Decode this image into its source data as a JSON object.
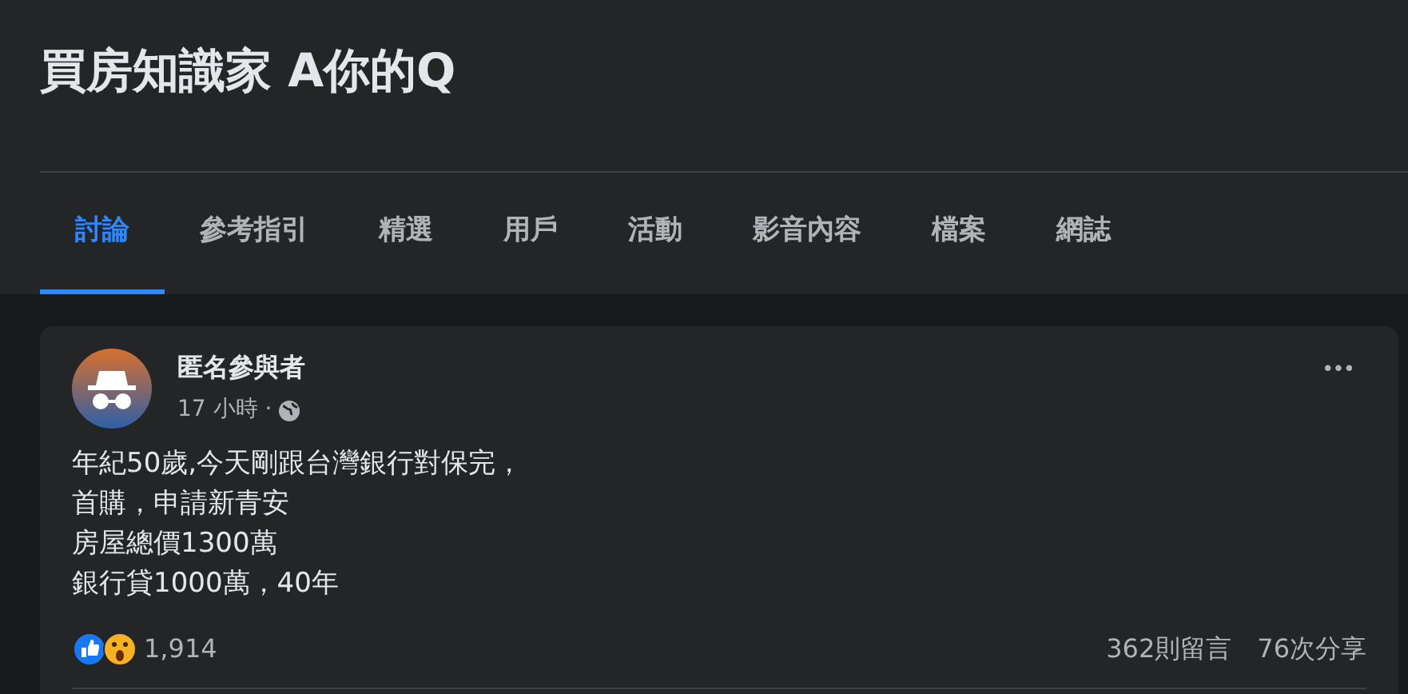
{
  "group": {
    "title": "買房知識家 A你的Q"
  },
  "tabs": [
    {
      "label": "討論",
      "selected": true
    },
    {
      "label": "參考指引",
      "selected": false
    },
    {
      "label": "精選",
      "selected": false
    },
    {
      "label": "用戶",
      "selected": false
    },
    {
      "label": "活動",
      "selected": false
    },
    {
      "label": "影音內容",
      "selected": false
    },
    {
      "label": "檔案",
      "selected": false
    },
    {
      "label": "網誌",
      "selected": false
    }
  ],
  "post": {
    "author": "匿名參與者",
    "time": "17 小時 ·",
    "more": "•••",
    "lines": [
      "年紀50歲,今天剛跟台灣銀行對保完，",
      "首購，申請新青安",
      "房屋總價1300萬",
      "銀行貸1000萬，40年"
    ],
    "reaction_count": "1,914",
    "comments": "362則留言",
    "shares": "76次分享"
  }
}
